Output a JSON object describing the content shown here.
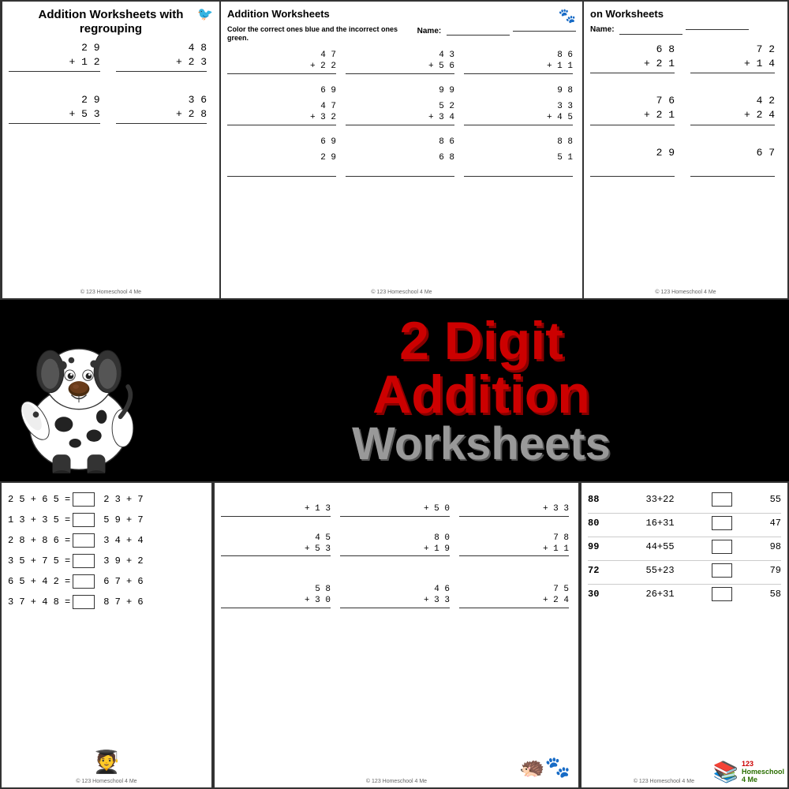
{
  "page": {
    "title": "2 Digit Addition Worksheets",
    "banner": {
      "line1": "2 Digit",
      "line2": "Addition",
      "line3": "Worksheets"
    }
  },
  "top_panels": [
    {
      "id": "panel1",
      "title": "Addition Worksheets with regrouping",
      "problems": [
        {
          "top": "2 9",
          "bottom": "+ 1 2",
          "answer": ""
        },
        {
          "top": "4 8",
          "bottom": "+ 2 3",
          "answer": ""
        },
        {
          "top": "2 9",
          "bottom": "+ 5 3",
          "answer": ""
        },
        {
          "top": "3 6",
          "bottom": "+ 2 8",
          "answer": ""
        }
      ]
    },
    {
      "id": "panel2",
      "title": "Addition Worksheets",
      "subtitle": "Color the correct ones blue and the incorrect ones green.",
      "name_label": "Name:",
      "problems": [
        {
          "top": "4 7",
          "bottom": "+ 2 2",
          "answer": "6 9"
        },
        {
          "top": "4 3",
          "bottom": "+ 5 6",
          "answer": "9 9"
        },
        {
          "top": "8 6",
          "bottom": "+ 1 1",
          "answer": "9 8"
        },
        {
          "top": "4 7",
          "bottom": "+ 3 2",
          "answer": "6 9"
        },
        {
          "top": "5 2",
          "bottom": "+ 3 4",
          "answer": "8 6"
        },
        {
          "top": "3 3",
          "bottom": "+ 4 5",
          "answer": "8 8"
        },
        {
          "top": "2 9",
          "bottom": "",
          "answer": ""
        },
        {
          "top": "6 8",
          "bottom": "",
          "answer": ""
        },
        {
          "top": "5 1",
          "bottom": "",
          "answer": ""
        }
      ]
    },
    {
      "id": "panel3",
      "title": "on Worksheets",
      "name_label": "Name:",
      "problems": [
        {
          "top": "6 8",
          "bottom": "+ 2 1",
          "answer": ""
        },
        {
          "top": "7 2",
          "bottom": "+ 1 4",
          "answer": ""
        },
        {
          "top": "7 6",
          "bottom": "+ 2 1",
          "answer": ""
        },
        {
          "top": "4 2",
          "bottom": "+ 2 4",
          "answer": ""
        },
        {
          "top": "2 9",
          "bottom": "",
          "answer": ""
        },
        {
          "top": "6 7",
          "bottom": "",
          "answer": ""
        }
      ]
    }
  ],
  "bottom_panels": [
    {
      "id": "bp1",
      "type": "equations",
      "rows": [
        {
          "eq": "2 5 + 6 5 =",
          "second": "2 3 + 7"
        },
        {
          "eq": "1 3 + 3 5 =",
          "second": "5 9 + 7"
        },
        {
          "eq": "2 8 + 8 6 =",
          "second": "3 4 + 4"
        },
        {
          "eq": "3 5 + 7 5 =",
          "second": "3 9 + 2"
        },
        {
          "eq": "6 5 + 4 2 =",
          "second": "6 7 + 6"
        },
        {
          "eq": "3 7 + 4 8 =",
          "second": "8 7 + 6"
        }
      ]
    },
    {
      "id": "bp2",
      "type": "vertical",
      "header_problems": [
        {
          "bottom": "+ 1 3"
        },
        {
          "bottom": "+ 5 0"
        },
        {
          "bottom": "+ 3 3"
        }
      ],
      "problems": [
        {
          "top": "4 5",
          "bottom": "+ 5 3",
          "answer": ""
        },
        {
          "top": "8 0",
          "bottom": "+ 1 9",
          "answer": ""
        },
        {
          "top": "7 8",
          "bottom": "+ 1 1",
          "answer": ""
        },
        {
          "top": "5 8",
          "bottom": "+ 3 0",
          "answer": ""
        },
        {
          "top": "4 6",
          "bottom": "+ 3 3",
          "answer": ""
        },
        {
          "top": "7 5",
          "bottom": "+ 2 4",
          "answer": ""
        }
      ]
    },
    {
      "id": "bp3",
      "type": "answer-check",
      "rows": [
        {
          "num1": "88",
          "eq": "33+22",
          "box": true,
          "answer": "55"
        },
        {
          "num1": "80",
          "eq": "16+31",
          "box": true,
          "answer": "47"
        },
        {
          "num1": "99",
          "eq": "44+55",
          "box": true,
          "answer": "98"
        },
        {
          "num1": "72",
          "eq": "55+23",
          "box": true,
          "answer": "79"
        },
        {
          "num1": "30",
          "eq": "26+31",
          "box": true,
          "answer": "58"
        }
      ]
    }
  ],
  "copyright": "© 123 Homeschool 4 Me",
  "logo": "123Homeschool"
}
